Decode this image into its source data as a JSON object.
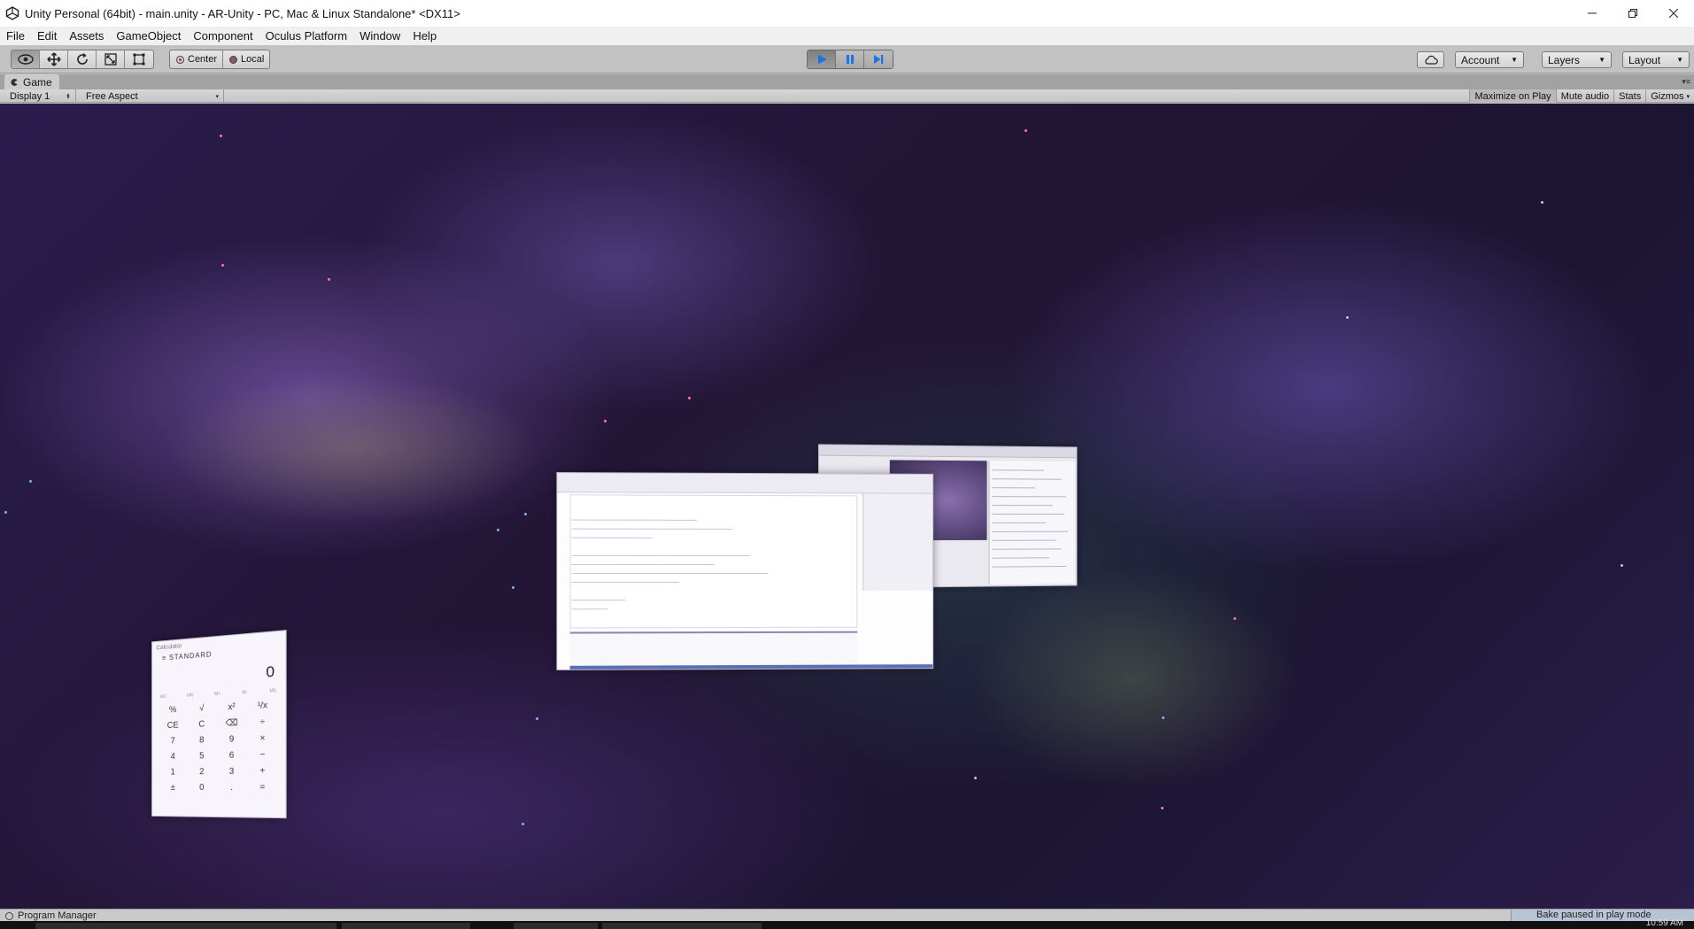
{
  "window": {
    "title": "Unity Personal (64bit) - main.unity - AR-Unity - PC, Mac & Linux Standalone* <DX11>"
  },
  "menu": [
    "File",
    "Edit",
    "Assets",
    "GameObject",
    "Component",
    "Oculus Platform",
    "Window",
    "Help"
  ],
  "toolbar": {
    "pivot_label": "Center",
    "space_label": "Local",
    "account_label": "Account",
    "layers_label": "Layers",
    "layout_label": "Layout"
  },
  "game_tab": {
    "label": "Game",
    "display": "Display 1",
    "aspect": "Free Aspect",
    "maximize_on_play": "Maximize on Play",
    "mute_audio": "Mute audio",
    "stats": "Stats",
    "gizmos": "Gizmos"
  },
  "calculator": {
    "title": "Calculator",
    "mode": "STANDARD",
    "display": "0",
    "memory": [
      "MC",
      "MR",
      "M+",
      "M-",
      "MS"
    ],
    "keys": [
      "%",
      "√",
      "x²",
      "¹/x",
      "CE",
      "C",
      "⌫",
      "÷",
      "7",
      "8",
      "9",
      "×",
      "4",
      "5",
      "6",
      "−",
      "1",
      "2",
      "3",
      "+",
      "±",
      "0",
      ".",
      "="
    ]
  },
  "status": {
    "left_text": "Program Manager",
    "right_text": "Bake paused in play mode"
  },
  "taskbar": {
    "clock": "10:59 AM"
  },
  "colors": {
    "title_bg": "#ffffff",
    "toolbar_bg": "#c2c2c2",
    "play_accent": "#1a73e8"
  }
}
